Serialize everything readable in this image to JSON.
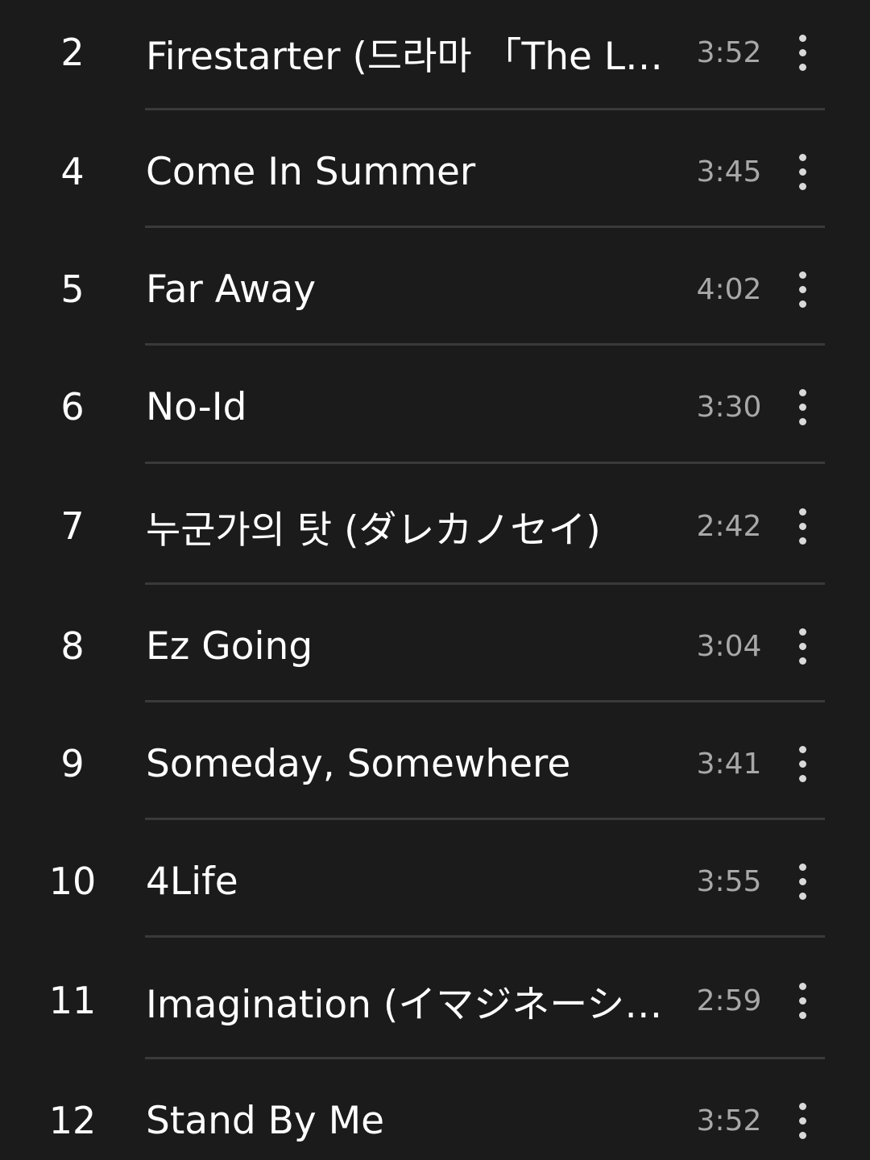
{
  "tracks": [
    {
      "number": "2",
      "title": "Firestarter (드라마 「The L…",
      "duration": "3:52"
    },
    {
      "number": "4",
      "title": "Come In Summer",
      "duration": "3:45"
    },
    {
      "number": "5",
      "title": "Far Away",
      "duration": "4:02"
    },
    {
      "number": "6",
      "title": "No-Id",
      "duration": "3:30"
    },
    {
      "number": "7",
      "title": "누군가의 탓 (ダレカノセイ)",
      "duration": "2:42"
    },
    {
      "number": "8",
      "title": "Ez Going",
      "duration": "3:04"
    },
    {
      "number": "9",
      "title": "Someday, Somewhere",
      "duration": "3:41"
    },
    {
      "number": "10",
      "title": "4Life",
      "duration": "3:55"
    },
    {
      "number": "11",
      "title": "Imagination (イマジネーシ…",
      "duration": "2:59"
    },
    {
      "number": "12",
      "title": "Stand By Me",
      "duration": "3:52"
    }
  ],
  "row_action_icon": "more-vertical-icon",
  "colors": {
    "background": "#1b1b1b",
    "title": "#ffffff",
    "duration": "#a8a8a8",
    "divider": "#3a3a3a"
  }
}
